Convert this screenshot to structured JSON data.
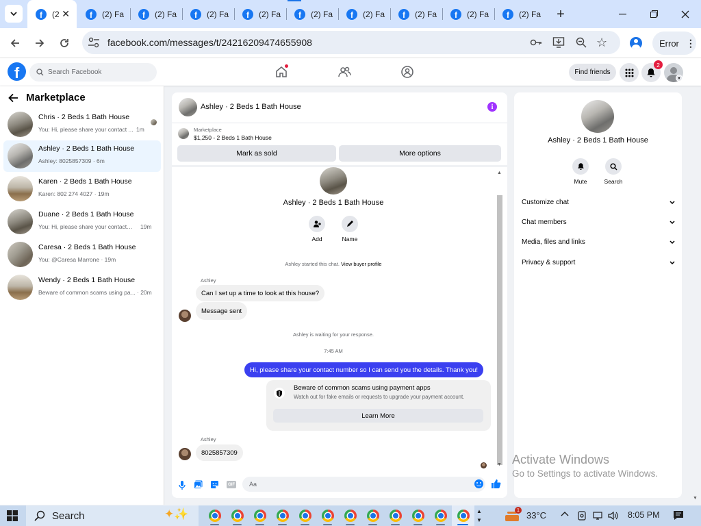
{
  "browser": {
    "tabs": [
      {
        "title": "(2"
      },
      {
        "title": "(2) Fa"
      },
      {
        "title": "(2) Fa"
      },
      {
        "title": "(2) Fa"
      },
      {
        "title": "(2) Fa"
      },
      {
        "title": "(2) Fa"
      },
      {
        "title": "(2) Fa"
      },
      {
        "title": "(2) Fa"
      },
      {
        "title": "(2) Fa"
      },
      {
        "title": "(2) Fa"
      },
      {
        "title": "(2) Fa"
      }
    ],
    "url": "facebook.com/messages/t/24216209474655908",
    "profile_button": "Error"
  },
  "fb_header": {
    "search_placeholder": "Search Facebook",
    "find_friends": "Find friends",
    "notification_count": "2",
    "colors": {
      "brand": "#1877f2",
      "badge": "#e41e3f"
    }
  },
  "left_panel": {
    "title": "Marketplace",
    "conversations": [
      {
        "name": "Chris · 2 Beds 1 Bath House",
        "preview": "You: Hi, please share your contact ...",
        "time": "1m"
      },
      {
        "name": "Ashley · 2 Beds 1 Bath House",
        "preview": "Ashley: 8025857309 · 6m",
        "time": ""
      },
      {
        "name": "Karen · 2 Beds 1 Bath House",
        "preview": "Karen: 802 274 4027 · 19m",
        "time": ""
      },
      {
        "name": "Duane · 2 Beds 1 Bath House",
        "preview": "You: Hi, please share your contact n...",
        "time": "19m"
      },
      {
        "name": "Caresa · 2 Beds 1 Bath House",
        "preview": "You: @Caresa Marrone · 19m",
        "time": ""
      },
      {
        "name": "Wendy · 2 Beds 1 Bath House",
        "preview": "Beware of common scams using pa...",
        "time": "· 20m"
      }
    ]
  },
  "chat": {
    "header_title": "Ashley · 2 Beds 1 Bath House",
    "listing_label": "Marketplace",
    "listing_price_title": "$1,250 - 2 Beds 1 Bath House",
    "mark_sold": "Mark as sold",
    "more_options": "More options",
    "profile_name": "Ashley · 2 Beds 1 Bath House",
    "add_label": "Add",
    "name_label": "Name",
    "started_text": "Ashley started this chat.",
    "view_buyer": "View buyer profile",
    "sender1": "Ashley",
    "msg1": "Can I set up a time to look at this house?",
    "msg2": "Message sent",
    "waiting": "Ashley is waiting for your response.",
    "time_divider": "7:45 AM",
    "my_msg": "Hi, please share your contact number so I can send you the details. Thank you!",
    "warn_title": "Beware of common scams using payment apps",
    "warn_body": "Watch out for fake emails or requests to upgrade your payment account.",
    "learn_more": "Learn More",
    "sender2": "Ashley",
    "msg3": "8025857309",
    "composer_placeholder": "Aa",
    "colors": {
      "accent": "#0a7cff",
      "my_bubble": "#3b40f0",
      "info": "#a033ff"
    }
  },
  "right_panel": {
    "name": "Ashley · 2 Beds 1 Bath House",
    "mute": "Mute",
    "search": "Search",
    "sections": [
      "Customize chat",
      "Chat members",
      "Media, files and links",
      "Privacy & support"
    ]
  },
  "watermark": {
    "line1": "Activate Windows",
    "line2": "Go to Settings to activate Windows."
  },
  "taskbar": {
    "search": "Search",
    "weather": "33°C",
    "weather_badge": "1",
    "time": "8:05 PM"
  }
}
